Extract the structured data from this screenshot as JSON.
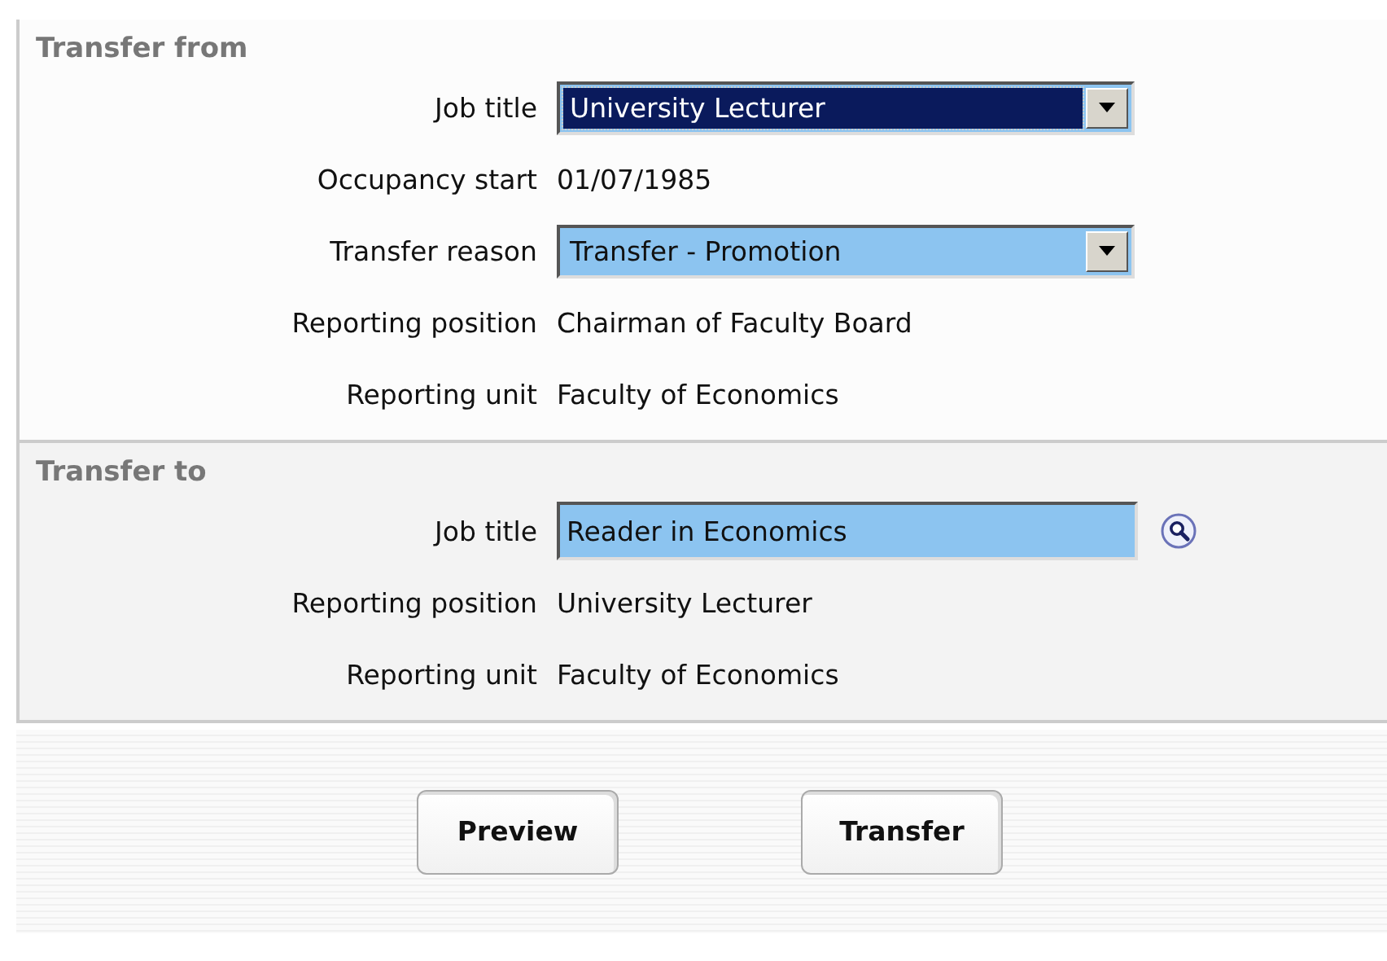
{
  "sections": [
    {
      "title": "Transfer from",
      "shaded": false,
      "rows": [
        {
          "label": "Job title",
          "kind": "select",
          "value": "University Lecturer",
          "focused": true
        },
        {
          "label": "Occupancy start",
          "kind": "text",
          "value": "01/07/1985"
        },
        {
          "label": "Transfer reason",
          "kind": "select",
          "value": "Transfer - Promotion",
          "focused": false
        },
        {
          "label": "Reporting position",
          "kind": "text",
          "value": "Chairman of Faculty Board"
        },
        {
          "label": "Reporting unit",
          "kind": "text",
          "value": "Faculty of Economics"
        }
      ]
    },
    {
      "title": "Transfer to",
      "shaded": true,
      "rows": [
        {
          "label": "Job title",
          "kind": "lookup",
          "value": "Reader in Economics"
        },
        {
          "label": "Reporting position",
          "kind": "text",
          "value": "University Lecturer"
        },
        {
          "label": "Reporting unit",
          "kind": "text",
          "value": "Faculty of Economics"
        }
      ]
    }
  ],
  "buttons": [
    "Preview",
    "Transfer"
  ]
}
